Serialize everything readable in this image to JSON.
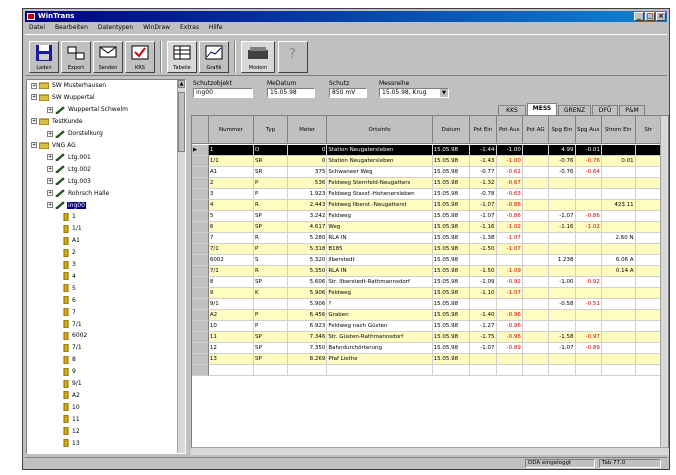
{
  "window": {
    "title": "WinTrans",
    "min": "_",
    "max": "□",
    "close": "×"
  },
  "menu": [
    "Datei",
    "Bearbeiten",
    "Datentypen",
    "WinDraw",
    "Extras",
    "Hilfe"
  ],
  "toolbar": {
    "buttons": [
      {
        "label": "Laden",
        "icon": "floppy-icon"
      },
      {
        "label": "Export",
        "icon": "export-icon"
      },
      {
        "label": "Senden",
        "icon": "send-icon"
      },
      {
        "label": "KRS",
        "icon": "krs-icon"
      },
      {
        "label": "Tabelle",
        "icon": "table-icon"
      },
      {
        "label": "Grafik",
        "icon": "chart-icon"
      },
      {
        "label": "Modem",
        "icon": "modem-icon"
      },
      {
        "label": "",
        "icon": "help-icon"
      }
    ]
  },
  "tree": {
    "nodes": [
      {
        "label": "SW Musterhausen",
        "level": 0,
        "type": "folder"
      },
      {
        "label": "SW Wuppertal",
        "level": 0,
        "type": "folder"
      },
      {
        "label": "Wuppertal Schwelm",
        "level": 1,
        "type": "pencil"
      },
      {
        "label": "TestKunde",
        "level": 0,
        "type": "folder"
      },
      {
        "label": "Dorstelkurg",
        "level": 1,
        "type": "pencil"
      },
      {
        "label": "VNG AG",
        "level": 0,
        "type": "folder"
      },
      {
        "label": "Ltg.001",
        "level": 1,
        "type": "pencil"
      },
      {
        "label": "Ltg.002",
        "level": 1,
        "type": "pencil"
      },
      {
        "label": "Ltg.003",
        "level": 1,
        "type": "pencil"
      },
      {
        "label": "Rohrsch Halle",
        "level": 1,
        "type": "pencil"
      },
      {
        "label": "ing00",
        "level": 1,
        "type": "pencil",
        "selected": true
      },
      {
        "label": "1",
        "level": 2,
        "type": "post"
      },
      {
        "label": "1/1",
        "level": 2,
        "type": "post"
      },
      {
        "label": "A1",
        "level": 2,
        "type": "post"
      },
      {
        "label": "2",
        "level": 2,
        "type": "post"
      },
      {
        "label": "3",
        "level": 2,
        "type": "post"
      },
      {
        "label": "4",
        "level": 2,
        "type": "post"
      },
      {
        "label": "5",
        "level": 2,
        "type": "post"
      },
      {
        "label": "6",
        "level": 2,
        "type": "post"
      },
      {
        "label": "7",
        "level": 2,
        "type": "post"
      },
      {
        "label": "7/1",
        "level": 2,
        "type": "post"
      },
      {
        "label": "6002",
        "level": 2,
        "type": "post"
      },
      {
        "label": "7/1",
        "level": 2,
        "type": "post"
      },
      {
        "label": "8",
        "level": 2,
        "type": "post"
      },
      {
        "label": "9",
        "level": 2,
        "type": "post"
      },
      {
        "label": "9/1",
        "level": 2,
        "type": "post"
      },
      {
        "label": "A2",
        "level": 2,
        "type": "post"
      },
      {
        "label": "10",
        "level": 2,
        "type": "post"
      },
      {
        "label": "11",
        "level": 2,
        "type": "post"
      },
      {
        "label": "12",
        "level": 2,
        "type": "post"
      },
      {
        "label": "13",
        "level": 2,
        "type": "post"
      }
    ]
  },
  "fields": {
    "schutzobjekt_label": "Schutzobjekt",
    "schutzobjekt": "ing00",
    "ma_datum_label": "MeDatum",
    "ma_datum": "15.05.98",
    "schutz_label": "Schutz",
    "schutz": "850 mV",
    "messreihe_label": "Messreihe",
    "messreihe": "15.05.98, Krug"
  },
  "tabs": [
    "KKS",
    "MESS",
    "GRENZ",
    "DFÜ",
    "P&M"
  ],
  "active_tab": "MESS",
  "grid": {
    "columns": [
      "Nummer",
      "Typ",
      "Meter",
      "Ortsinfo",
      "Datum",
      "Pot Ein",
      "Pot Aus",
      "Pot AG",
      "Spg Ein",
      "Spg Aus",
      "Strom Ein",
      "Str"
    ],
    "rows": [
      {
        "c": [
          "1",
          "D",
          "0",
          "Station Neugatersleben",
          "15.05.98",
          "-1.44",
          "-1.00",
          "",
          "4.99",
          "-0.01",
          "",
          ""
        ],
        "sel": true
      },
      {
        "c": [
          "1/1",
          "SR",
          "0",
          "Station Neugatersleben",
          "15.05.98",
          "-1.43",
          "-1.00",
          "",
          "-0.76",
          "-0.76",
          "0.01",
          ""
        ]
      },
      {
        "c": [
          "A1",
          "SR",
          "375",
          "Schwaneer Weg",
          "15.05.98",
          "-0.77",
          "-0.62",
          "",
          "-0.76",
          "-0.64",
          "",
          ""
        ]
      },
      {
        "c": [
          "2",
          "P",
          "536",
          "Feldweg Sternfeld-Neugatters",
          "15.05.98",
          "-1.32",
          "-0.67",
          "",
          "",
          "",
          "",
          ""
        ]
      },
      {
        "c": [
          "3",
          "P",
          "1.923",
          "Feldweg Stassf.-Hohenerxleben",
          "15.05.98",
          "-0.78",
          "-0.63",
          "",
          "",
          "",
          "",
          ""
        ]
      },
      {
        "c": [
          "4",
          "R",
          "2.443",
          "Feldweg Ilberst.-Neugatterst",
          "15.05.98",
          "-1.07",
          "-0.86",
          "",
          "",
          "",
          "423.11",
          ""
        ]
      },
      {
        "c": [
          "5",
          "SP",
          "3.242",
          "Feldweg",
          "15.05.98",
          "-1.07",
          "-0.86",
          "",
          "-1.07",
          "-0.86",
          "",
          ""
        ]
      },
      {
        "c": [
          "6",
          "SP",
          "4.617",
          "Weg",
          "15.05.98",
          "-1.16",
          "-1.02",
          "",
          "-1.16",
          "-1.02",
          "",
          ""
        ]
      },
      {
        "c": [
          "7",
          "R",
          "5.280",
          "RLA       IN",
          "15.05.98",
          "-1.38",
          "-1.07",
          "",
          "",
          "",
          "2.60 N",
          ""
        ]
      },
      {
        "c": [
          "7/1",
          "P",
          "5.318",
          "B185",
          "15.05.98",
          "-1.50",
          "-1.07",
          "",
          "",
          "",
          "",
          ""
        ]
      },
      {
        "c": [
          "6002",
          "S",
          "5.320",
          "Ilberstedt",
          "15.05.98",
          "",
          "",
          "",
          "1.238",
          "",
          "6.06 A",
          ""
        ]
      },
      {
        "c": [
          "7/1",
          "R",
          "5.350",
          "RLA       IN",
          "15.05.98",
          "-1.50",
          "-1.09",
          "",
          "",
          "",
          "0.14 A",
          ""
        ]
      },
      {
        "c": [
          "8",
          "SP",
          "5.606",
          "Str. Ilberstedt-Rathmannsdorf",
          "15.05.98",
          "-1.09",
          "-0.92",
          "",
          "-1.00",
          "-0.92",
          "",
          ""
        ]
      },
      {
        "c": [
          "9",
          "K",
          "5.906",
          "Feldweg",
          "15.05.98",
          "-1.10",
          "-1.07",
          "",
          "",
          "",
          "",
          ""
        ]
      },
      {
        "c": [
          "9/1",
          "",
          "5.906",
          "?",
          "15.05.98",
          "",
          "",
          "",
          "-0.58",
          "-0.51",
          "",
          ""
        ]
      },
      {
        "c": [
          "A2",
          "P",
          "6.456",
          "Graben",
          "15.05.98",
          "-1.40",
          "-0.96",
          "",
          "",
          "",
          "",
          ""
        ]
      },
      {
        "c": [
          "10",
          "P",
          "6.923",
          "Feldweg nach Güsten",
          "15.05.98",
          "-1.27",
          "-0.96",
          "",
          "",
          "",
          "",
          ""
        ]
      },
      {
        "c": [
          "11",
          "SP",
          "7.346",
          "Str. Güsten-Rathmannsdorf",
          "15.05.98",
          "-1.75",
          "-0.96",
          "",
          "-1.58",
          "-0.97",
          "",
          ""
        ]
      },
      {
        "c": [
          "12",
          "SP",
          "7.350",
          "Bahndurchörterung",
          "15.05.98",
          "-1.07",
          "-0.89",
          "",
          "-1.07",
          "-0.89",
          "",
          ""
        ]
      },
      {
        "c": [
          "13",
          "SP",
          "8.269",
          "Pfaf Liethe",
          "15.05.98",
          "",
          "",
          "",
          "",
          "",
          "",
          ""
        ]
      },
      {
        "c": [
          "",
          "",
          "",
          "",
          "",
          "",
          "",
          "",
          "",
          "",
          "",
          ""
        ]
      }
    ]
  },
  "status": {
    "mode": "DDA eingeloggt",
    "right": "Tab 77.0"
  },
  "colors": {
    "title_start": "#000080",
    "title_end": "#1084d0",
    "row_yellow": "#fffcc0",
    "selected_row": "#000000",
    "red_value": "#d00000"
  }
}
